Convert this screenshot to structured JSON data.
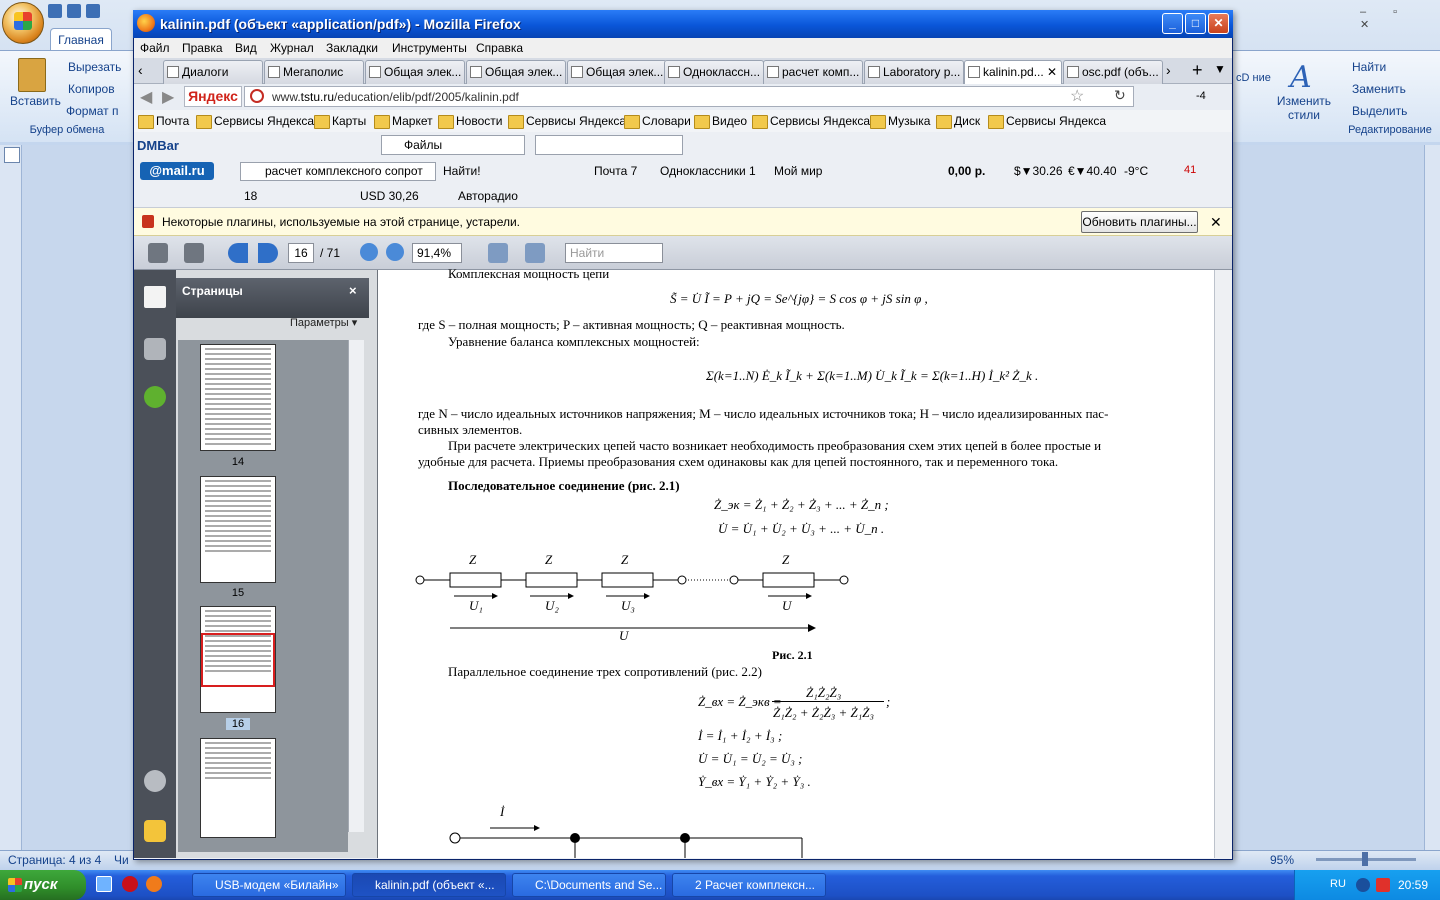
{
  "word": {
    "tab_home": "Главная",
    "paste": "Вставить",
    "cut": "Вырезать",
    "copy": "Копиров",
    "format": "Формат п",
    "clipboard_group": "Буфер обмена",
    "styles_icon": "A",
    "change_styles": "Изменить стили",
    "styles_fragment": "cD ние",
    "find": "Найти",
    "replace": "Заменить",
    "select": "Выделить",
    "editing_group": "Редактирование",
    "status_page": "Страница: 4 из 4",
    "status_words": "Чи",
    "zoom": "95%"
  },
  "firefox": {
    "title": "kalinin.pdf (объект «application/pdf») - Mozilla Firefox",
    "menu": [
      "Файл",
      "Правка",
      "Вид",
      "Журнал",
      "Закладки",
      "Инструменты",
      "Справка"
    ],
    "tabs": [
      {
        "label": "Диалоги"
      },
      {
        "label": "Мегаполис"
      },
      {
        "label": "Общая элек..."
      },
      {
        "label": "Общая элек..."
      },
      {
        "label": "Общая элек..."
      },
      {
        "label": "Одноклассн..."
      },
      {
        "label": "расчет комп..."
      },
      {
        "label": "Laboratory p..."
      },
      {
        "label": "kalinin.pd..."
      },
      {
        "label": "osc.pdf (объ..."
      }
    ],
    "yandex_logo": "Яндекс",
    "url_prefix": "www.",
    "url_host": "tstu.ru",
    "url_path": "/education/elib/pdf/2005/kalinin.pdf",
    "weather_value": "-4",
    "bookmarks": [
      "Почта",
      "Сервисы Яндекса",
      "Карты",
      "Маркет",
      "Новости",
      "Сервисы Яндекса",
      "Словари",
      "Видео",
      "Сервисы Яндекса",
      "Музыка",
      "Диск",
      "Сервисы Яндекса"
    ],
    "dmbar": "DMBar",
    "files_select": "Файлы",
    "mailru": "@mail.ru",
    "mail_search_value": "расчет комплексного сопрот",
    "find_btn": "Найти!",
    "mail_count": "Почта 7",
    "ok_count": "Одноклассники 1",
    "my_world": "Мой мир",
    "money": "0,00 р.",
    "usd_rate": "$▼30.26",
    "eur_rate": "€▼40.40",
    "temperature": "-9°C",
    "count_41": "41",
    "count_18": "18",
    "usd_box": "USD 30,26",
    "radio": "Авторадио",
    "plugin_message": "Некоторые плагины, используемые на этой странице, устарели.",
    "plugin_button": "Обновить плагины..."
  },
  "pdf": {
    "page_current": "16",
    "page_total": "/ 71",
    "zoom": "91,4%",
    "find_placeholder": "Найти",
    "pages_title": "Страницы",
    "pages_close": "×",
    "params": "Параметры ▾",
    "thumb_labels": [
      "14",
      "15",
      "16"
    ],
    "content": {
      "line_complex_power": "Комплексная мощность цепи",
      "formula_S": "S̃ = U̇ Ĩ = P + jQ = Se^{jφ} = S cos φ + jS sin φ ,",
      "line_where_S": "где S – полная мощность; P – активная мощность; Q – реактивная мощность.",
      "line_balance": "Уравнение баланса комплексных мощностей:",
      "formula_balance": "Σ(k=1..N) Ė_k Ĩ_k + Σ(k=1..M) U̇_k Ĩ_k = Σ(k=1..H) İ_k² Ż_k .",
      "line_where_N1": "где   N – число идеальных источников напряжения; M – число идеальных источников тока; H – число идеализированных пас-",
      "line_where_N2": "сивных элементов.",
      "line_calc1": "При расчете электрических цепей часто возникает необходимость преобразования схем этих цепей в более простые и",
      "line_calc2": "удобные для расчета. Приемы преобразования схем одинаковы как для цепей постоянного, так и переменного тока.",
      "heading_series": "Последовательное соединение (рис. 2.1)",
      "formula_Zek": "Ż_эк = Ż₁ + Ż₂ + Ż₃ + ... + Ż_n ;",
      "formula_U": "U̇ = U̇₁ + U̇₂ + U̇₃ + ... + U̇_n .",
      "fig_labels_Z": [
        "Z",
        "Z",
        "Z",
        "Z"
      ],
      "fig_labels_U": [
        "U₁",
        "U₂",
        "U₃",
        "U",
        "U"
      ],
      "fig_caption": "Рис. 2.1",
      "line_parallel": "Параллельное соединение трех сопротивлений (рис. 2.2)",
      "formula_Zvx_left": "Ż_вх = Ż_экв =",
      "formula_Zvx_num": "Ż₁Ż₂Ż₃",
      "formula_Zvx_den": "Ż₁Ż₂ + Ż₂Ż₃ + Ż₁Ż₃",
      "formula_Zvx_end": ";",
      "formula_I": "İ = İ₁ + İ₂ + İ₃ ;",
      "formula_U2": "U̇ = U̇₁ = U̇₂ = U̇₃ ;",
      "formula_Y": "Ẏ_вх = Ẏ₁ + Ẏ₂ + Ẏ₃ .",
      "fig2_label_I": "İ"
    }
  },
  "taskbar": {
    "start": "пуск",
    "tasks": [
      "USB-модем «Билайн»",
      "kalinin.pdf (объект «...",
      "C:\\Documents and Se...",
      "2 Расчет комплексн..."
    ],
    "lang": "RU",
    "clock": "20:59"
  },
  "colors": {
    "xp_blue": "#245edb",
    "start_green": "#2f8d2a",
    "word_ribbon": "#c4d6ee",
    "pdf_panel": "#4b5059"
  }
}
